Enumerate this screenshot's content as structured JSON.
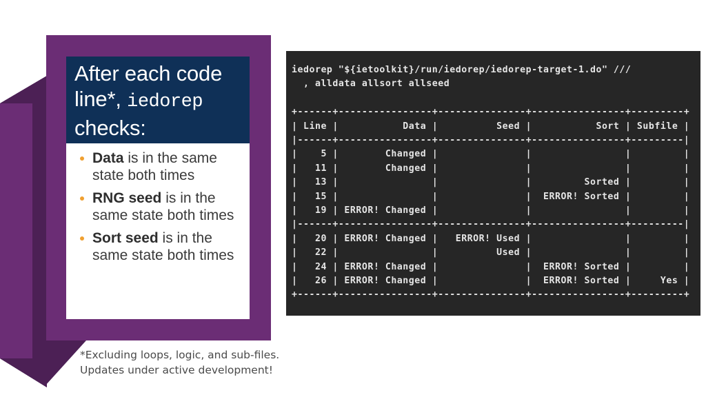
{
  "slide": {
    "title_lines": [
      "After each code",
      "line*, ",
      "checks:"
    ],
    "title_mono_word": "iedorep",
    "bullets": [
      {
        "bold": "Data",
        "rest": " is in the same state both times"
      },
      {
        "bold": "RNG seed",
        "rest": " is in the same state both times"
      },
      {
        "bold": "Sort seed",
        "rest": " is in the same state both times"
      }
    ],
    "footnote_line1": "*Excluding loops, logic, and sub-files.",
    "footnote_line2": "Updates under active development!",
    "colors": {
      "purple_main": "#6B2D75",
      "purple_shadow": "#4C2055",
      "title_navy": "#0F3057",
      "bullet_dot": "#F0A030",
      "terminal_bg": "#262626",
      "terminal_fg": "#E6E6E6"
    }
  },
  "terminal": {
    "command_lines": [
      "iedorep \"${ietoolkit}/run/iedorep/iedorep-target-1.do\" ///",
      "  , alldata allsort allseed"
    ],
    "table": {
      "columns": [
        "Line",
        "Data",
        "Seed",
        "Sort",
        "Subfile"
      ],
      "rule_top": "+------+----------------+---------------+----------------+---------+",
      "header_row": "| Line |           Data |          Seed |           Sort | Subfile |",
      "rule_mid_1": "|------+----------------+---------------+----------------+---------|",
      "rule_mid_2": "|------+----------------+---------------+----------------+---------|",
      "rule_bottom": "+------+----------------+---------------+----------------+---------+",
      "group_1": [
        {
          "line": "5",
          "data": "Changed",
          "seed": "",
          "sort": "",
          "subfile": ""
        },
        {
          "line": "11",
          "data": "Changed",
          "seed": "",
          "sort": "",
          "subfile": ""
        },
        {
          "line": "13",
          "data": "",
          "seed": "",
          "sort": "Sorted",
          "subfile": ""
        },
        {
          "line": "15",
          "data": "",
          "seed": "",
          "sort": "ERROR! Sorted",
          "subfile": ""
        },
        {
          "line": "19",
          "data": "ERROR! Changed",
          "seed": "",
          "sort": "",
          "subfile": ""
        }
      ],
      "group_2": [
        {
          "line": "20",
          "data": "ERROR! Changed",
          "seed": "ERROR! Used",
          "sort": "",
          "subfile": ""
        },
        {
          "line": "22",
          "data": "",
          "seed": "Used",
          "sort": "",
          "subfile": ""
        },
        {
          "line": "24",
          "data": "ERROR! Changed",
          "seed": "",
          "sort": "ERROR! Sorted",
          "subfile": ""
        },
        {
          "line": "26",
          "data": "ERROR! Changed",
          "seed": "",
          "sort": "ERROR! Sorted",
          "subfile": "Yes"
        }
      ],
      "rendered_rows": [
        "+------+----------------+---------------+----------------+---------+",
        "| Line |           Data |          Seed |           Sort | Subfile |",
        "|------+----------------+---------------+----------------+---------|",
        "|    5 |        Changed |               |                |         |",
        "|   11 |        Changed |               |                |         |",
        "|   13 |                |               |         Sorted |         |",
        "|   15 |                |               |  ERROR! Sorted |         |",
        "|   19 | ERROR! Changed |               |                |         |",
        "|------+----------------+---------------+----------------+---------|",
        "|   20 | ERROR! Changed |   ERROR! Used |                |         |",
        "|   22 |                |          Used |                |         |",
        "|   24 | ERROR! Changed |               |  ERROR! Sorted |         |",
        "|   26 | ERROR! Changed |               |  ERROR! Sorted |     Yes |",
        "+------+----------------+---------------+----------------+---------+"
      ]
    }
  }
}
